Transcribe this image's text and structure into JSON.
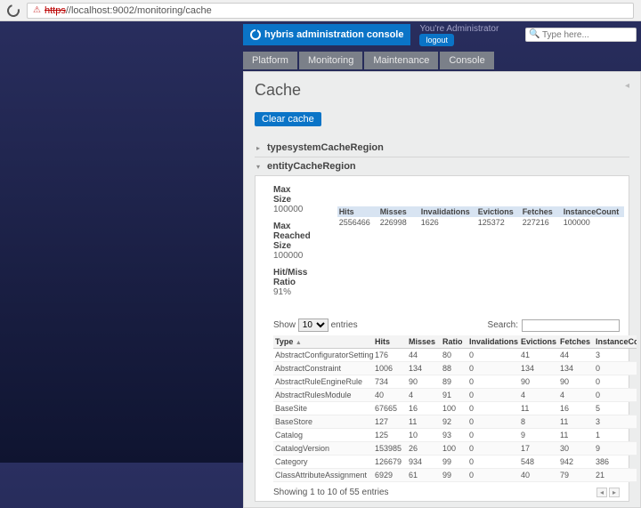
{
  "url": {
    "scheme": "https",
    "host": "//localhost",
    "rest": ":9002/monitoring/cache"
  },
  "brand": "hybris administration console",
  "user_text": "You're Administrator",
  "logout_label": "logout",
  "search_placeholder": "Type here...",
  "nav": [
    "Platform",
    "Monitoring",
    "Maintenance",
    "Console"
  ],
  "page_title": "Cache",
  "clear_cache_label": "Clear cache",
  "regions": [
    {
      "name": "typesystemCacheRegion",
      "expanded": false
    },
    {
      "name": "entityCacheRegion",
      "expanded": true
    }
  ],
  "entity": {
    "max_size_label": "Max Size",
    "max_size": "100000",
    "max_reached_label": "Max Reached Size",
    "max_reached": "100000",
    "ratio_label": "Hit/Miss Ratio",
    "ratio": "91%",
    "stats_head": [
      "Hits",
      "Misses",
      "Invalidations",
      "Evictions",
      "Fetches",
      "InstanceCount"
    ],
    "stats_vals": [
      "2556466",
      "226998",
      "1626",
      "125372",
      "227216",
      "100000"
    ]
  },
  "dt": {
    "show_label_pre": "Show",
    "show_label_post": "entries",
    "length_value": "10",
    "search_label": "Search:",
    "columns": [
      "Type",
      "Hits",
      "Misses",
      "Ratio",
      "Invalidations",
      "Evictions",
      "Fetches",
      "InstanceCount"
    ],
    "rows": [
      [
        "AbstractConfiguratorSetting",
        "176",
        "44",
        "80",
        "0",
        "41",
        "44",
        "3"
      ],
      [
        "AbstractConstraint",
        "1006",
        "134",
        "88",
        "0",
        "134",
        "134",
        "0"
      ],
      [
        "AbstractRuleEngineRule",
        "734",
        "90",
        "89",
        "0",
        "90",
        "90",
        "0"
      ],
      [
        "AbstractRulesModule",
        "40",
        "4",
        "91",
        "0",
        "4",
        "4",
        "0"
      ],
      [
        "BaseSite",
        "67665",
        "16",
        "100",
        "0",
        "11",
        "16",
        "5"
      ],
      [
        "BaseStore",
        "127",
        "11",
        "92",
        "0",
        "8",
        "11",
        "3"
      ],
      [
        "Catalog",
        "125",
        "10",
        "93",
        "0",
        "9",
        "11",
        "1"
      ],
      [
        "CatalogVersion",
        "153985",
        "26",
        "100",
        "0",
        "17",
        "30",
        "9"
      ],
      [
        "Category",
        "126679",
        "934",
        "99",
        "0",
        "548",
        "942",
        "386"
      ],
      [
        "ClassAttributeAssignment",
        "6929",
        "61",
        "99",
        "0",
        "40",
        "79",
        "21"
      ]
    ],
    "info": "Showing 1 to 10 of 55 entries"
  }
}
